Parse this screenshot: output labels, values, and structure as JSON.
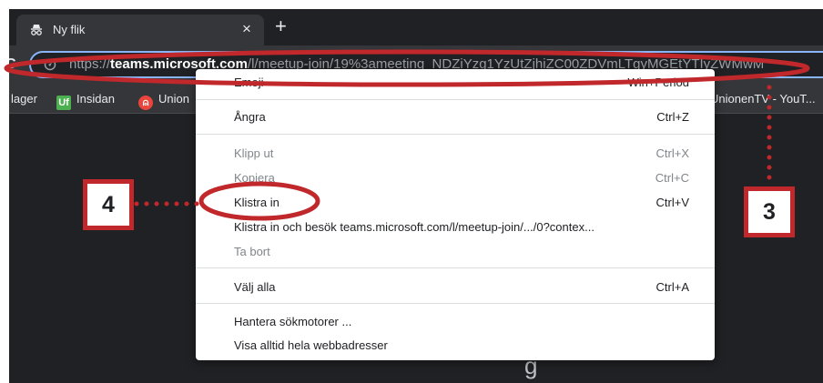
{
  "tab": {
    "title": "Ny flik",
    "icon": "incognito-icon",
    "close_glyph": "×"
  },
  "new_tab_glyph": "+",
  "reload_glyph": "C",
  "omnibox": {
    "icon": "site-info-icon",
    "scheme": "https://",
    "host": "teams.microsoft.com",
    "path": "/l/meetup-join/19%3ameeting_NDZiYzg1YzUtZjhiZC00ZDVmLTgyMGEtYTIyZWMwM"
  },
  "bookmarks": [
    {
      "label": "lager",
      "icon": ""
    },
    {
      "label": "Insidan",
      "icon": "uf-logo-icon",
      "glyph": "Uf"
    },
    {
      "label": "Union",
      "icon": "unionen-logo-icon",
      "glyph": "⍝"
    },
    {
      "label": "UnionenTV - YouT...",
      "icon": ""
    }
  ],
  "page_glyph": "g",
  "context_menu": {
    "items": [
      {
        "label": "Emoji",
        "shortcut": "Win+Period",
        "disabled": false
      },
      {
        "label": "Ångra",
        "shortcut": "Ctrl+Z",
        "disabled": false
      },
      {
        "label": "Klipp ut",
        "shortcut": "Ctrl+X",
        "disabled": true
      },
      {
        "label": "Kopiera",
        "shortcut": "Ctrl+C",
        "disabled": true
      },
      {
        "label": "Klistra in",
        "shortcut": "Ctrl+V",
        "disabled": false
      },
      {
        "label": "Klistra in och besök teams.microsoft.com/l/meetup-join/.../0?contex...",
        "shortcut": "",
        "disabled": false
      },
      {
        "label": "Ta bort",
        "shortcut": "",
        "disabled": true
      },
      {
        "label": "Välj alla",
        "shortcut": "Ctrl+A",
        "disabled": false
      },
      {
        "label": "Hantera sökmotorer ...",
        "shortcut": "",
        "disabled": false
      },
      {
        "label": "Visa alltid hela webbadresser",
        "shortcut": "",
        "disabled": false
      }
    ]
  },
  "annotations": {
    "color": "#c0282b",
    "step_3": "3",
    "step_4": "4"
  },
  "colors": {
    "accent": "#8ab4f8",
    "chrome_dark": "#202124",
    "toolbar": "#35363a"
  }
}
